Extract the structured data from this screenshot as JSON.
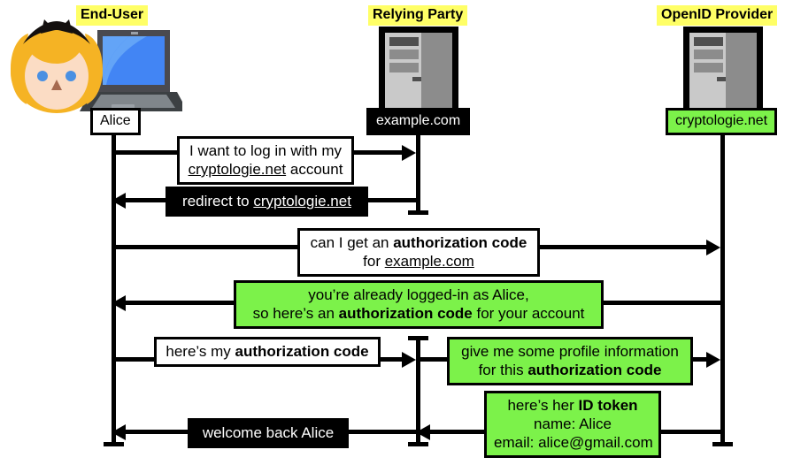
{
  "diagram": {
    "title_hidden": "OpenID Connect authorization code flow sequence diagram",
    "colors": {
      "highlight_yellow": "#ffff66",
      "accent_green": "#7cf24a",
      "dark": "#000000",
      "light": "#ffffff"
    }
  },
  "actors": [
    {
      "id": "end-user",
      "title": "End-User",
      "name_label": "Alice",
      "name_style": "light",
      "icon": "alice-avatar-laptop-icon"
    },
    {
      "id": "relying-party",
      "title": "Relying Party",
      "name_label": "example.com",
      "name_style": "dark",
      "icon": "server-tower-icon"
    },
    {
      "id": "openid-provider",
      "title": "OpenID Provider",
      "name_label": "cryptologie.net",
      "name_style": "green",
      "icon": "server-tower-icon"
    }
  ],
  "messages": [
    {
      "id": "msg-1",
      "style": "light",
      "from": "end-user",
      "to": "relying-party",
      "direction": "right",
      "lines": [
        [
          {
            "t": "I want to log in with my",
            "f": "n"
          }
        ],
        [
          {
            "t": "cryptologie.net",
            "f": "u"
          },
          {
            "t": " account",
            "f": "n"
          }
        ]
      ]
    },
    {
      "id": "msg-2",
      "style": "dark",
      "from": "relying-party",
      "to": "end-user",
      "direction": "left",
      "lines": [
        [
          {
            "t": "redirect to ",
            "f": "n"
          },
          {
            "t": "cryptologie.net",
            "f": "u"
          }
        ]
      ]
    },
    {
      "id": "msg-3",
      "style": "light",
      "from": "end-user",
      "to": "openid-provider",
      "direction": "right",
      "lines": [
        [
          {
            "t": "can I get an ",
            "f": "n"
          },
          {
            "t": "authorization code",
            "f": "b"
          }
        ],
        [
          {
            "t": "for ",
            "f": "n"
          },
          {
            "t": "example.com",
            "f": "u"
          }
        ]
      ]
    },
    {
      "id": "msg-4",
      "style": "green",
      "from": "openid-provider",
      "to": "end-user",
      "direction": "left",
      "lines": [
        [
          {
            "t": "you’re already logged-in as Alice,",
            "f": "n"
          }
        ],
        [
          {
            "t": "so here’s an ",
            "f": "n"
          },
          {
            "t": "authorization code",
            "f": "b"
          },
          {
            "t": " for your account",
            "f": "n"
          }
        ]
      ]
    },
    {
      "id": "msg-5",
      "style": "light",
      "from": "end-user",
      "to": "relying-party",
      "direction": "right",
      "lines": [
        [
          {
            "t": "here’s my ",
            "f": "n"
          },
          {
            "t": "authorization code",
            "f": "b"
          }
        ]
      ]
    },
    {
      "id": "msg-6",
      "style": "green",
      "from": "relying-party",
      "to": "openid-provider",
      "direction": "right",
      "lines": [
        [
          {
            "t": "give me some profile information",
            "f": "n"
          }
        ],
        [
          {
            "t": "for this ",
            "f": "n"
          },
          {
            "t": "authorization code",
            "f": "b"
          }
        ]
      ]
    },
    {
      "id": "msg-7",
      "style": "green",
      "from": "openid-provider",
      "to": "relying-party",
      "direction": "left",
      "lines": [
        [
          {
            "t": "here’s her ",
            "f": "n"
          },
          {
            "t": "ID token",
            "f": "b"
          }
        ],
        [
          {
            "t": "name: Alice",
            "f": "n"
          }
        ],
        [
          {
            "t": "email: alice@gmail.com",
            "f": "n"
          }
        ]
      ]
    },
    {
      "id": "msg-8",
      "style": "dark",
      "from": "relying-party",
      "to": "end-user",
      "direction": "left",
      "lines": [
        [
          {
            "t": "welcome back Alice",
            "f": "n"
          }
        ]
      ]
    }
  ]
}
